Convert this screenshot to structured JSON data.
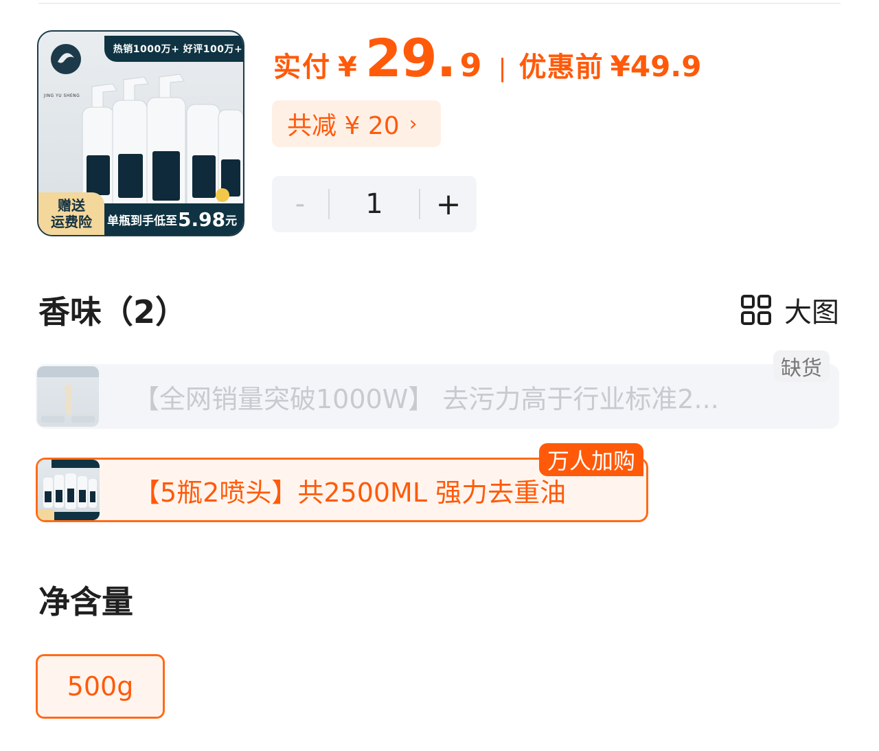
{
  "product": {
    "image_banner": "热销1000万+ 好评100万+",
    "image_badge_line1": "赠送",
    "image_badge_line2": "运费险",
    "image_bottom_prefix": "单瓶到手低至",
    "image_bottom_price": "5.98",
    "image_bottom_unit": "元",
    "logo_text": "JING YU SHENG"
  },
  "price": {
    "label": "实付",
    "currency": "¥",
    "integer": "29.",
    "decimal": "9",
    "separator": "|",
    "original_label": "优惠前",
    "original_value": "¥49.9"
  },
  "discount": {
    "label": "共减 ¥ 20",
    "chevron": "›"
  },
  "quantity": {
    "minus": "-",
    "value": "1",
    "plus": "+"
  },
  "scent": {
    "title": "香味（2）",
    "big_view_label": "大图",
    "options": [
      {
        "label": "【全网销量突破1000W】 去污力高于行业标准2...",
        "tag": "缺货",
        "state": "out-of-stock"
      },
      {
        "label": "【5瓶2喷头】共2500ML 强力去重油",
        "tag": "万人加购",
        "state": "selected"
      }
    ]
  },
  "net_content": {
    "title": "净含量",
    "options": [
      {
        "label": "500g",
        "state": "selected"
      }
    ]
  },
  "colors": {
    "accent": "#ff5a0a",
    "accent_bg": "#fff0e6",
    "disabled_text": "#c7cacf"
  }
}
